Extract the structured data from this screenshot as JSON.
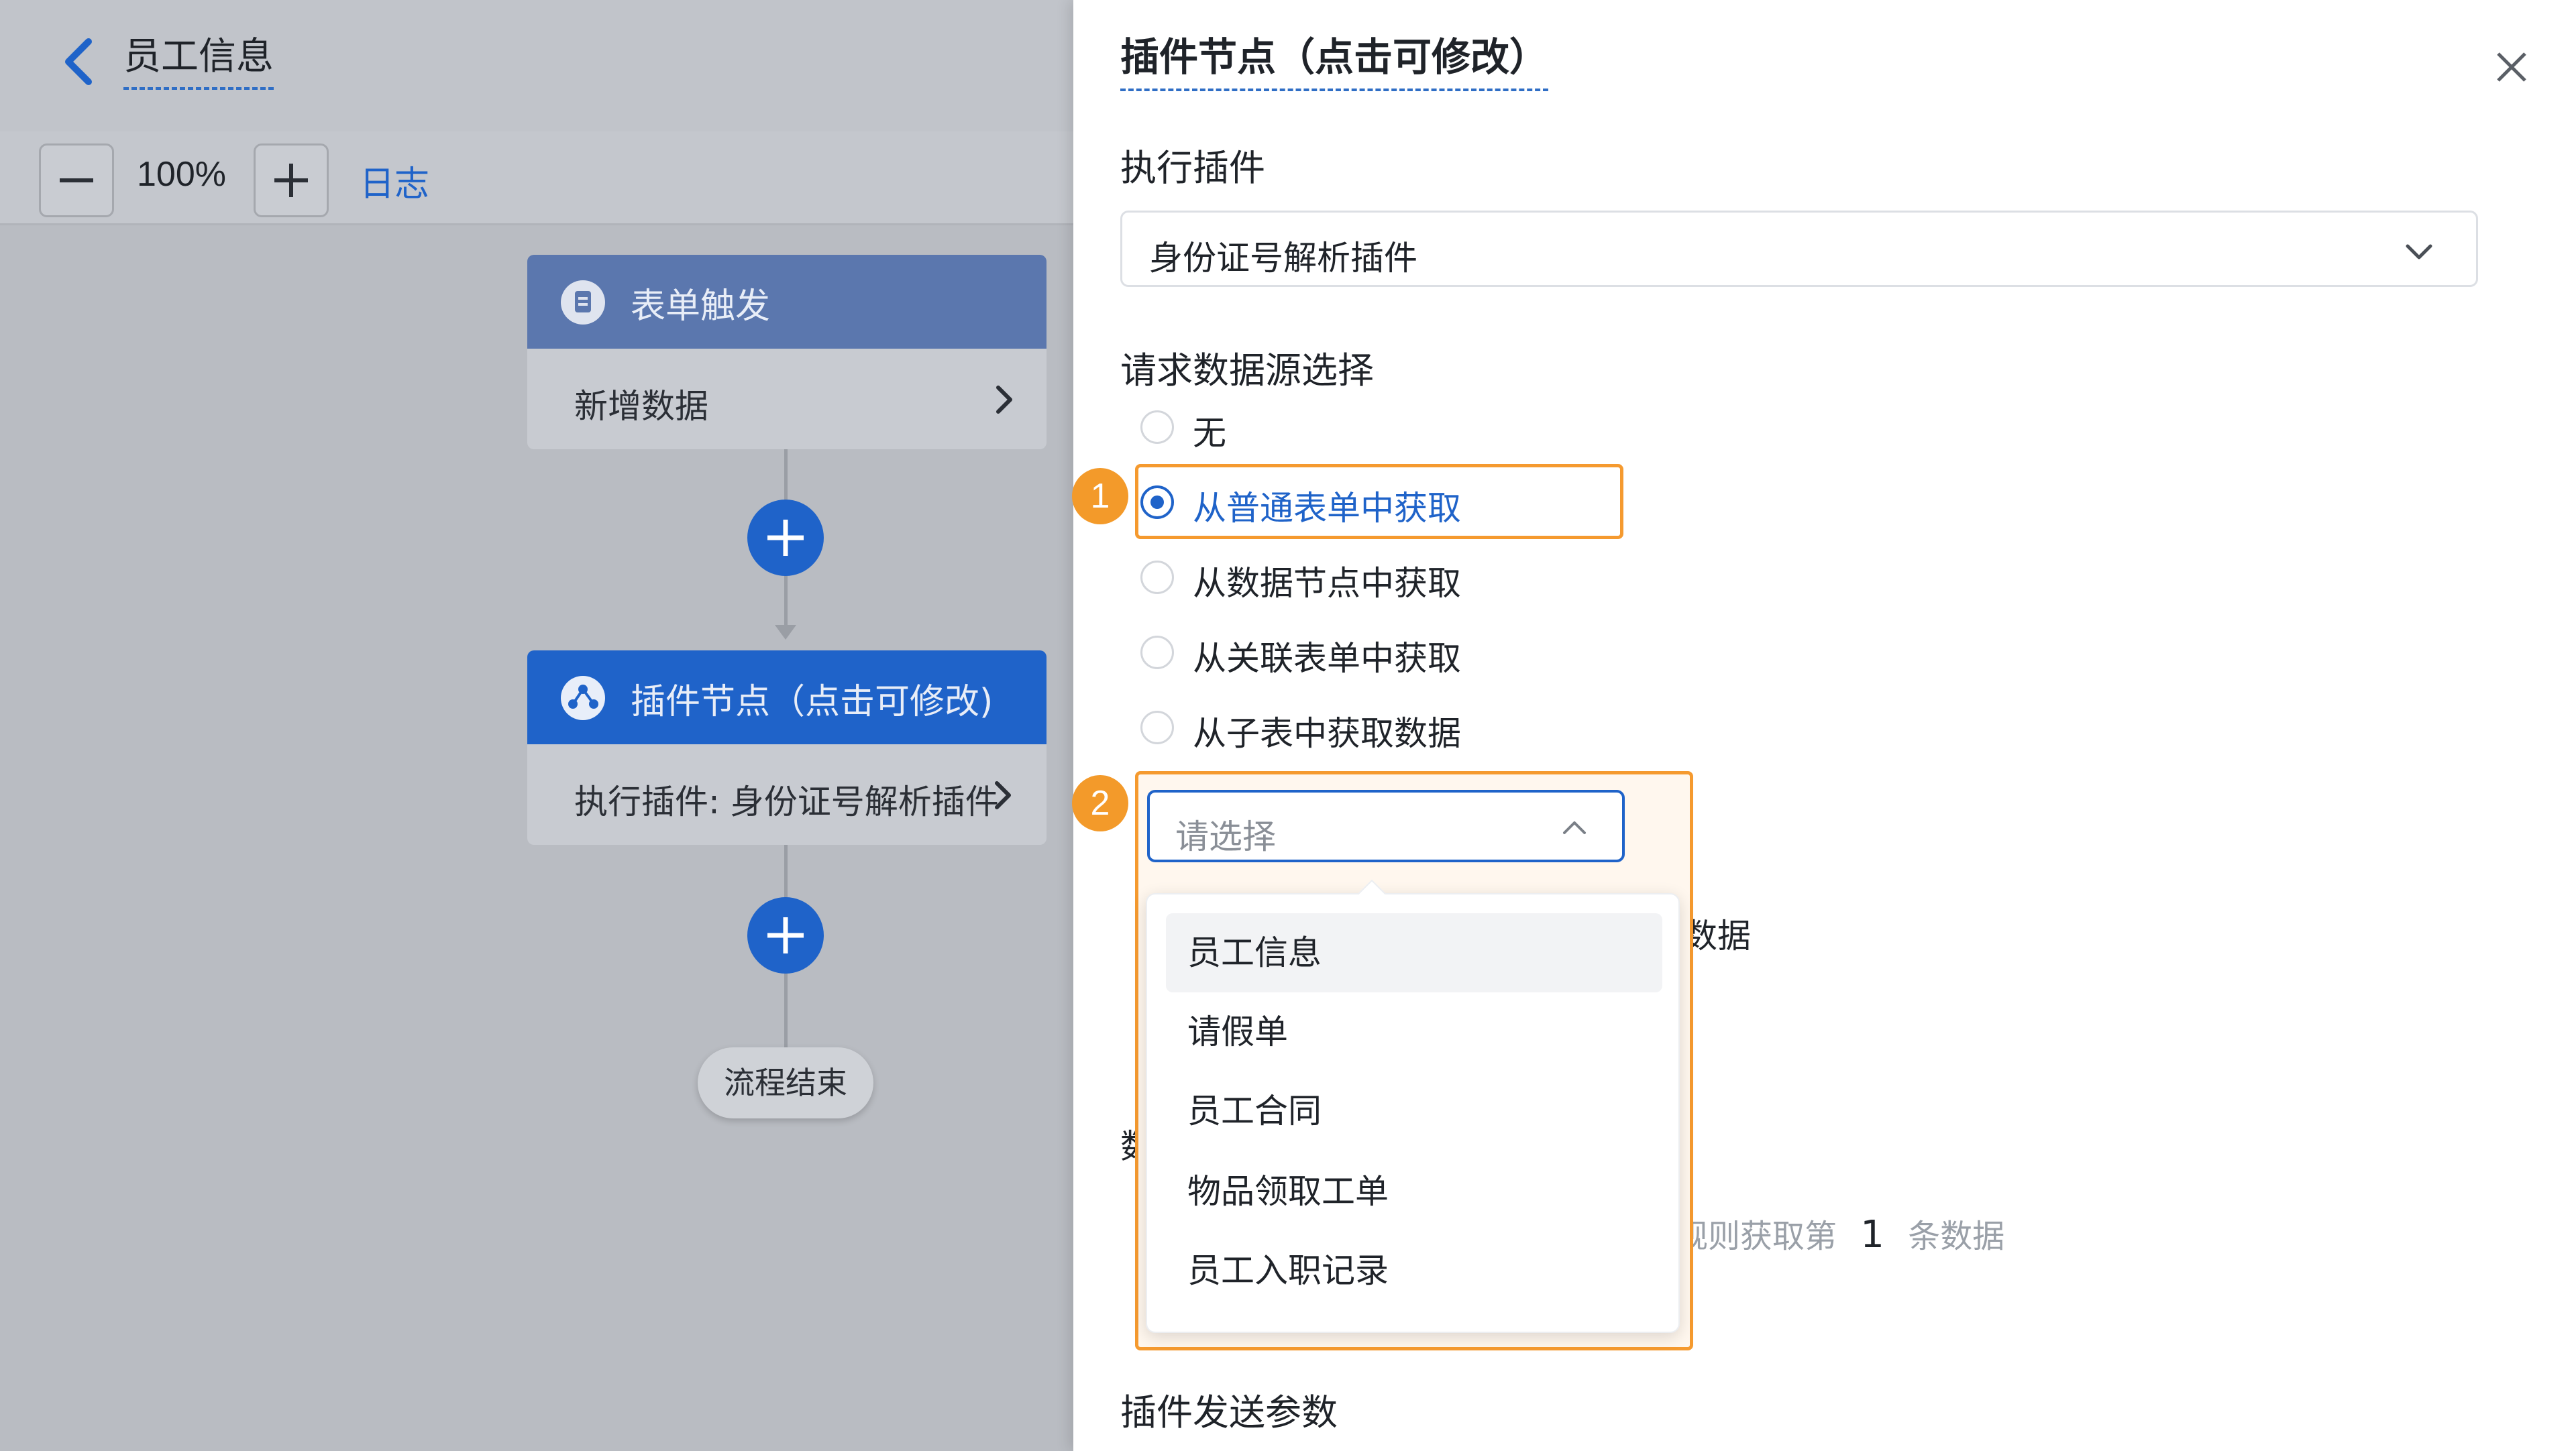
{
  "header": {
    "back_label": "back",
    "title": "员工信息"
  },
  "toolbar": {
    "zoom": "100%",
    "log_link": "日志"
  },
  "workflow": {
    "trigger_title": "表单触发",
    "trigger_detail": "新增数据",
    "plugin_title": "插件节点（点击可修改)",
    "plugin_detail": "执行插件: 身份证号解析插件",
    "end_label": "流程结束",
    "colors": {
      "trigger": "#5b77ae",
      "plugin": "#1f63c9"
    }
  },
  "panel": {
    "title": "插件节点（点击可修改）",
    "exec_plugin_label": "执行插件",
    "exec_plugin_value": "身份证号解析插件",
    "source_label": "请求数据源选择",
    "source_options": [
      {
        "label": "无",
        "selected": false
      },
      {
        "label": "从普通表单中获取",
        "selected": true
      },
      {
        "label": "从数据节点中获取",
        "selected": false
      },
      {
        "label": "从关联表单中获取",
        "selected": false
      },
      {
        "label": "从子表中获取数据",
        "selected": false
      }
    ],
    "form_select_placeholder": "请选择",
    "form_options": [
      "员工信息",
      "请假单",
      "员工合同",
      "物品领取工单",
      "员工入职记录"
    ],
    "hovered_option": "员工信息",
    "obscured_text_1": "的数据",
    "obscured_text_2": "数",
    "rule_text_prefix": "规则获取第",
    "rule_number": "1",
    "rule_text_suffix": "条数据",
    "obscured_text_3": ";",
    "send_params_label": "插件发送参数",
    "badges": [
      "1",
      "2"
    ],
    "accent_color": "#1f63c9",
    "highlight_color": "#f59a2f"
  }
}
